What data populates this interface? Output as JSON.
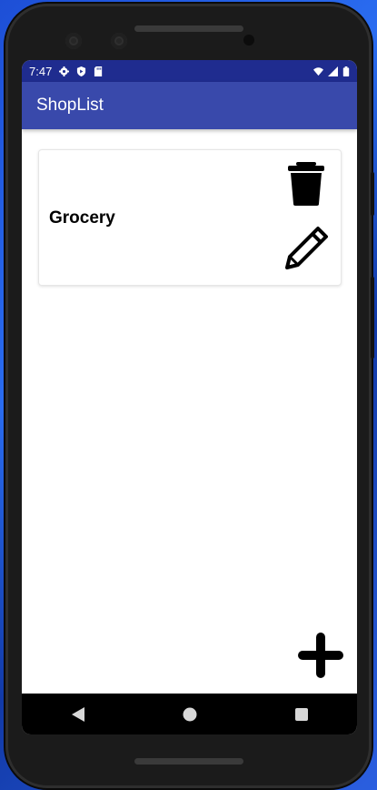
{
  "status_bar": {
    "time": "7:47",
    "left_icons": [
      "settings-icon",
      "shield-play-icon",
      "sd-card-icon"
    ],
    "right_icons": [
      "wifi-icon",
      "cell-signal-icon",
      "battery-icon"
    ]
  },
  "app_bar": {
    "title": "ShopList"
  },
  "lists": [
    {
      "name": "Grocery",
      "actions": [
        "delete-icon",
        "edit-icon"
      ]
    }
  ],
  "fab": {
    "icon": "add-icon"
  },
  "nav_bar": {
    "buttons": [
      "back-icon",
      "home-icon",
      "recents-icon"
    ]
  },
  "colors": {
    "status_bar": "#1f2c8f",
    "app_bar": "#3949ab",
    "app_bar_text": "#ffffff",
    "background": "#ffffff"
  }
}
